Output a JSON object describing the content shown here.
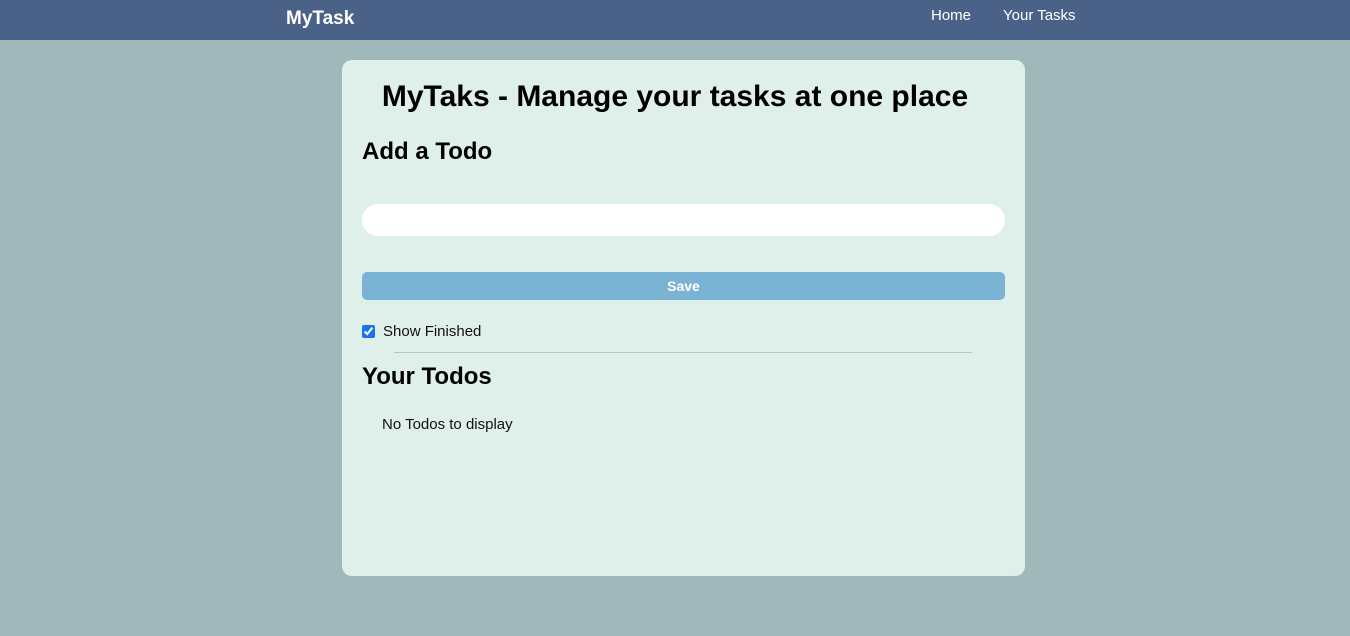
{
  "navbar": {
    "brand": "MyTask",
    "links": [
      "Home",
      "Your Tasks"
    ]
  },
  "main": {
    "title": "MyTaks - Manage your tasks at one place",
    "add_heading": "Add a Todo",
    "input_value": "",
    "save_label": "Save",
    "show_finished_label": "Show Finished",
    "show_finished_checked": true,
    "todos_heading": "Your Todos",
    "empty_message": "No Todos to display"
  },
  "colors": {
    "navbar": "#4a6188",
    "page_background": "#a1b8ba",
    "card_background": "#dff0eb",
    "save_button": "#7bb3d4"
  }
}
